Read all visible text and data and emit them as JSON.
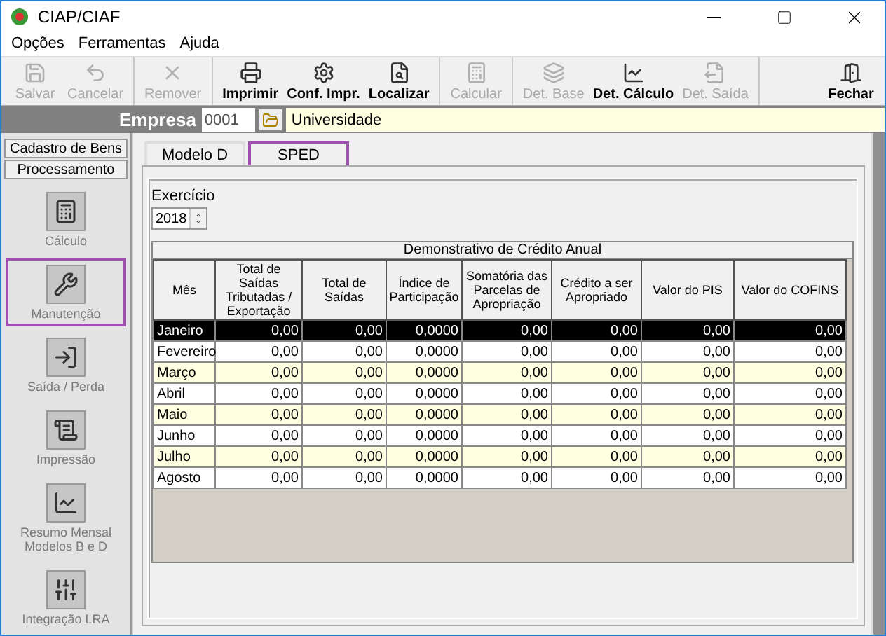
{
  "window": {
    "title": "CIAP/CIAF"
  },
  "menu": [
    "Opções",
    "Ferramentas",
    "Ajuda"
  ],
  "toolbar": [
    [
      {
        "label": "Salvar",
        "disabled": true
      },
      {
        "label": "Cancelar",
        "disabled": true
      }
    ],
    [
      {
        "label": "Remover",
        "disabled": true
      }
    ],
    [
      {
        "label": "Imprimir",
        "disabled": false
      },
      {
        "label": "Conf. Impr.",
        "disabled": false
      },
      {
        "label": "Localizar",
        "disabled": false
      }
    ],
    [
      {
        "label": "Calcular",
        "disabled": true
      }
    ],
    [
      {
        "label": "Det. Base",
        "disabled": true
      },
      {
        "label": "Det. Cálculo",
        "disabled": false
      },
      {
        "label": "Det. Saída",
        "disabled": true
      }
    ],
    [
      {
        "label": "Fechar",
        "disabled": false
      }
    ]
  ],
  "company": {
    "label": "Empresa",
    "code": "0001",
    "name": "Universidade"
  },
  "sidebar": {
    "sections": [
      "Cadastro de Bens",
      "Processamento"
    ],
    "items": [
      {
        "label": "Cálculo",
        "selected": false
      },
      {
        "label": "Manutenção",
        "selected": true
      },
      {
        "label": "Saída / Perda",
        "selected": false
      },
      {
        "label": "Impressão",
        "selected": false
      },
      {
        "label": "Resumo Mensal Modelos B e D",
        "selected": false
      },
      {
        "label": "Integração LRA",
        "selected": false
      }
    ]
  },
  "tabs": [
    {
      "label": "Modelo D",
      "selected": false
    },
    {
      "label": "SPED",
      "selected": true
    }
  ],
  "exercise": {
    "label": "Exercício",
    "value": "2018"
  },
  "table": {
    "caption": "Demonstrativo de Crédito Anual",
    "columns": [
      "Mês",
      "Total de Saídas Tributadas / Exportação",
      "Total de Saídas",
      "Índice de Participação",
      "Somatória das Parcelas de Apropriação",
      "Crédito a ser Apropriado",
      "Valor do PIS",
      "Valor do COFINS"
    ],
    "rows": [
      {
        "cells": [
          "Janeiro",
          "0,00",
          "0,00",
          "0,0000",
          "0,00",
          "0,00",
          "0,00",
          "0,00"
        ],
        "selected": true
      },
      {
        "cells": [
          "Fevereiro",
          "0,00",
          "0,00",
          "0,0000",
          "0,00",
          "0,00",
          "0,00",
          "0,00"
        ],
        "selected": false
      },
      {
        "cells": [
          "Março",
          "0,00",
          "0,00",
          "0,0000",
          "0,00",
          "0,00",
          "0,00",
          "0,00"
        ],
        "selected": false
      },
      {
        "cells": [
          "Abril",
          "0,00",
          "0,00",
          "0,0000",
          "0,00",
          "0,00",
          "0,00",
          "0,00"
        ],
        "selected": false
      },
      {
        "cells": [
          "Maio",
          "0,00",
          "0,00",
          "0,0000",
          "0,00",
          "0,00",
          "0,00",
          "0,00"
        ],
        "selected": false
      },
      {
        "cells": [
          "Junho",
          "0,00",
          "0,00",
          "0,0000",
          "0,00",
          "0,00",
          "0,00",
          "0,00"
        ],
        "selected": false
      },
      {
        "cells": [
          "Julho",
          "0,00",
          "0,00",
          "0,0000",
          "0,00",
          "0,00",
          "0,00",
          "0,00"
        ],
        "selected": false
      },
      {
        "cells": [
          "Agosto",
          "0,00",
          "0,00",
          "0,0000",
          "0,00",
          "0,00",
          "0,00",
          "0,00"
        ],
        "selected": false
      }
    ]
  }
}
